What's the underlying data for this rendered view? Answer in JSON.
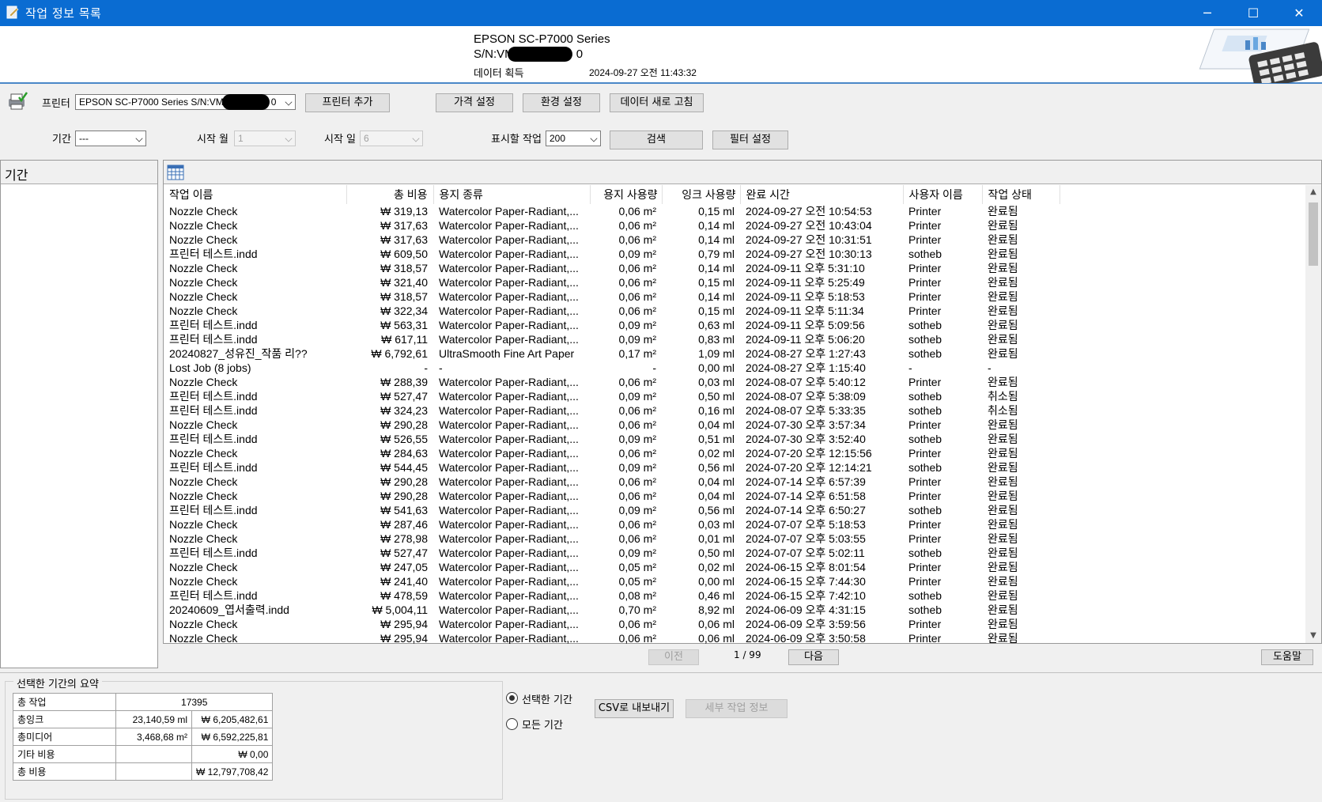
{
  "window": {
    "title": "작업 정보 목록"
  },
  "header": {
    "printer_model": "EPSON SC-P7000 Series",
    "serial_prefix": "S/N:VM",
    "serial_suffix": "0",
    "acquired_label": "데이터 획득",
    "acquired_time": "2024-09-27 오전 11:43:32"
  },
  "toolbar": {
    "printer_label": "프린터",
    "printer_value": "EPSON SC-P7000 Series S/N:VM",
    "printer_value_suffix": "0",
    "add_printer": "프린터 추가",
    "price_settings": "가격 설정",
    "env_settings": "환경 설정",
    "refresh": "데이터 새로 고침"
  },
  "filter": {
    "period_label": "기간",
    "period_value": "---",
    "start_month_label": "시작 월",
    "start_month_value": "1",
    "start_day_label": "시작 일",
    "start_day_value": "6",
    "display_jobs_label": "표시할 작업",
    "display_jobs_value": "200",
    "search": "검색",
    "filter_settings": "필터 설정"
  },
  "left_pane": {
    "title": "기간"
  },
  "grid": {
    "columns": [
      "작업 이름",
      "총 비용",
      "용지 종류",
      "용지 사용량",
      "잉크 사용량",
      "완료 시간",
      "사용자 이름",
      "작업 상태"
    ],
    "rows": [
      [
        "Nozzle Check",
        "₩ 319,13",
        "Watercolor Paper-Radiant,...",
        "0,06 m²",
        "0,15 ml",
        "2024-09-27 오전 10:54:53",
        "Printer",
        "완료됨"
      ],
      [
        "Nozzle Check",
        "₩ 317,63",
        "Watercolor Paper-Radiant,...",
        "0,06 m²",
        "0,14 ml",
        "2024-09-27 오전 10:43:04",
        "Printer",
        "완료됨"
      ],
      [
        "Nozzle Check",
        "₩ 317,63",
        "Watercolor Paper-Radiant,...",
        "0,06 m²",
        "0,14 ml",
        "2024-09-27 오전 10:31:51",
        "Printer",
        "완료됨"
      ],
      [
        "프린터 테스트.indd",
        "₩ 609,50",
        "Watercolor Paper-Radiant,...",
        "0,09 m²",
        "0,79 ml",
        "2024-09-27 오전 10:30:13",
        "sotheb",
        "완료됨"
      ],
      [
        "Nozzle Check",
        "₩ 318,57",
        "Watercolor Paper-Radiant,...",
        "0,06 m²",
        "0,14 ml",
        "2024-09-11 오후 5:31:10",
        "Printer",
        "완료됨"
      ],
      [
        "Nozzle Check",
        "₩ 321,40",
        "Watercolor Paper-Radiant,...",
        "0,06 m²",
        "0,15 ml",
        "2024-09-11 오후 5:25:49",
        "Printer",
        "완료됨"
      ],
      [
        "Nozzle Check",
        "₩ 318,57",
        "Watercolor Paper-Radiant,...",
        "0,06 m²",
        "0,14 ml",
        "2024-09-11 오후 5:18:53",
        "Printer",
        "완료됨"
      ],
      [
        "Nozzle Check",
        "₩ 322,34",
        "Watercolor Paper-Radiant,...",
        "0,06 m²",
        "0,15 ml",
        "2024-09-11 오후 5:11:34",
        "Printer",
        "완료됨"
      ],
      [
        "프린터 테스트.indd",
        "₩ 563,31",
        "Watercolor Paper-Radiant,...",
        "0,09 m²",
        "0,63 ml",
        "2024-09-11 오후 5:09:56",
        "sotheb",
        "완료됨"
      ],
      [
        "프린터 테스트.indd",
        "₩ 617,11",
        "Watercolor Paper-Radiant,...",
        "0,09 m²",
        "0,83 ml",
        "2024-09-11 오후 5:06:20",
        "sotheb",
        "완료됨"
      ],
      [
        "20240827_성유진_작품 리??",
        "₩ 6,792,61",
        "UltraSmooth Fine Art Paper",
        "0,17 m²",
        "1,09 ml",
        "2024-08-27 오후 1:27:43",
        "sotheb",
        "완료됨"
      ],
      [
        "Lost Job (8 jobs)",
        "-",
        "-",
        "-",
        "0,00 ml",
        "2024-08-27 오후 1:15:40",
        "-",
        "-"
      ],
      [
        "Nozzle Check",
        "₩ 288,39",
        "Watercolor Paper-Radiant,...",
        "0,06 m²",
        "0,03 ml",
        "2024-08-07 오후 5:40:12",
        "Printer",
        "완료됨"
      ],
      [
        "프린터 테스트.indd",
        "₩ 527,47",
        "Watercolor Paper-Radiant,...",
        "0,09 m²",
        "0,50 ml",
        "2024-08-07 오후 5:38:09",
        "sotheb",
        "취소됨"
      ],
      [
        "프린터 테스트.indd",
        "₩ 324,23",
        "Watercolor Paper-Radiant,...",
        "0,06 m²",
        "0,16 ml",
        "2024-08-07 오후 5:33:35",
        "sotheb",
        "취소됨"
      ],
      [
        "Nozzle Check",
        "₩ 290,28",
        "Watercolor Paper-Radiant,...",
        "0,06 m²",
        "0,04 ml",
        "2024-07-30 오후 3:57:34",
        "Printer",
        "완료됨"
      ],
      [
        "프린터 테스트.indd",
        "₩ 526,55",
        "Watercolor Paper-Radiant,...",
        "0,09 m²",
        "0,51 ml",
        "2024-07-30 오후 3:52:40",
        "sotheb",
        "완료됨"
      ],
      [
        "Nozzle Check",
        "₩ 284,63",
        "Watercolor Paper-Radiant,...",
        "0,06 m²",
        "0,02 ml",
        "2024-07-20 오후 12:15:56",
        "Printer",
        "완료됨"
      ],
      [
        "프린터 테스트.indd",
        "₩ 544,45",
        "Watercolor Paper-Radiant,...",
        "0,09 m²",
        "0,56 ml",
        "2024-07-20 오후 12:14:21",
        "sotheb",
        "완료됨"
      ],
      [
        "Nozzle Check",
        "₩ 290,28",
        "Watercolor Paper-Radiant,...",
        "0,06 m²",
        "0,04 ml",
        "2024-07-14 오후 6:57:39",
        "Printer",
        "완료됨"
      ],
      [
        "Nozzle Check",
        "₩ 290,28",
        "Watercolor Paper-Radiant,...",
        "0,06 m²",
        "0,04 ml",
        "2024-07-14 오후 6:51:58",
        "Printer",
        "완료됨"
      ],
      [
        "프린터 테스트.indd",
        "₩ 541,63",
        "Watercolor Paper-Radiant,...",
        "0,09 m²",
        "0,56 ml",
        "2024-07-14 오후 6:50:27",
        "sotheb",
        "완료됨"
      ],
      [
        "Nozzle Check",
        "₩ 287,46",
        "Watercolor Paper-Radiant,...",
        "0,06 m²",
        "0,03 ml",
        "2024-07-07 오후 5:18:53",
        "Printer",
        "완료됨"
      ],
      [
        "Nozzle Check",
        "₩ 278,98",
        "Watercolor Paper-Radiant,...",
        "0,06 m²",
        "0,01 ml",
        "2024-07-07 오후 5:03:55",
        "Printer",
        "완료됨"
      ],
      [
        "프린터 테스트.indd",
        "₩ 527,47",
        "Watercolor Paper-Radiant,...",
        "0,09 m²",
        "0,50 ml",
        "2024-07-07 오후 5:02:11",
        "sotheb",
        "완료됨"
      ],
      [
        "Nozzle Check",
        "₩ 247,05",
        "Watercolor Paper-Radiant,...",
        "0,05 m²",
        "0,02 ml",
        "2024-06-15 오후 8:01:54",
        "Printer",
        "완료됨"
      ],
      [
        "Nozzle Check",
        "₩ 241,40",
        "Watercolor Paper-Radiant,...",
        "0,05 m²",
        "0,00 ml",
        "2024-06-15 오후 7:44:30",
        "Printer",
        "완료됨"
      ],
      [
        "프린터 테스트.indd",
        "₩ 478,59",
        "Watercolor Paper-Radiant,...",
        "0,08 m²",
        "0,46 ml",
        "2024-06-15 오후 7:42:10",
        "sotheb",
        "완료됨"
      ],
      [
        "20240609_엽서출력.indd",
        "₩ 5,004,11",
        "Watercolor Paper-Radiant,...",
        "0,70 m²",
        "8,92 ml",
        "2024-06-09 오후 4:31:15",
        "sotheb",
        "완료됨"
      ],
      [
        "Nozzle Check",
        "₩ 295,94",
        "Watercolor Paper-Radiant,...",
        "0,06 m²",
        "0,06 ml",
        "2024-06-09 오후 3:59:56",
        "Printer",
        "완료됨"
      ],
      [
        "Nozzle Check",
        "₩ 295,94",
        "Watercolor Paper-Radiant,...",
        "0,06 m²",
        "0,06 ml",
        "2024-06-09 오후 3:50:58",
        "Printer",
        "완료됨"
      ]
    ]
  },
  "pager": {
    "prev": "이전",
    "page": "1 / 99",
    "next": "다음",
    "help": "도움말"
  },
  "summary": {
    "title": "선택한 기간의 요약",
    "rows": [
      [
        "총 작업",
        "17395",
        ""
      ],
      [
        "총잉크",
        "23,140,59 ml",
        "₩ 6,205,482,61"
      ],
      [
        "총미디어",
        "3,468,68 m²",
        "₩ 6,592,225,81"
      ],
      [
        "기타 비용",
        "",
        "₩ 0,00"
      ],
      [
        "총 비용",
        "",
        "₩ 12,797,708,42"
      ]
    ],
    "radio_selected": "선택한 기간",
    "radio_all": "모든 기간",
    "csv_export": "CSV로 내보내기",
    "job_details": "세부 작업 정보"
  }
}
